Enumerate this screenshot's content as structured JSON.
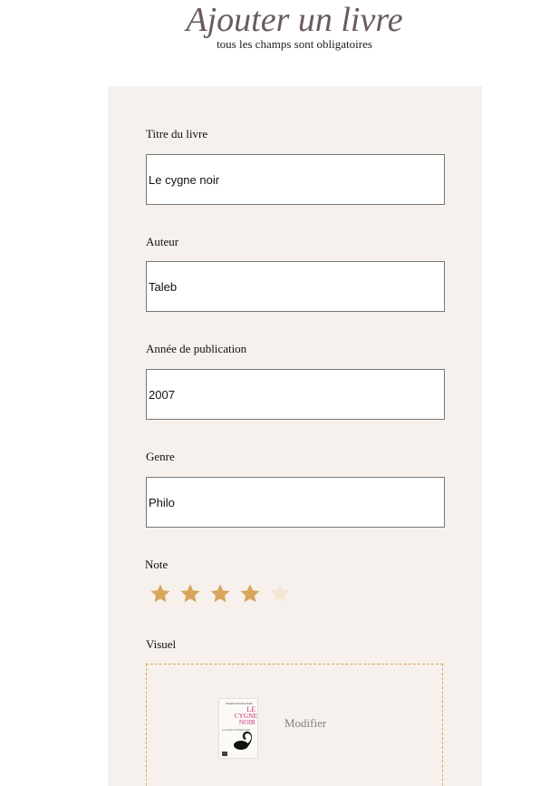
{
  "header": {
    "title": "Ajouter un livre",
    "subtitle": "tous les champs sont obligatoires"
  },
  "form": {
    "fields": [
      {
        "label": "Titre du livre",
        "value": "Le cygne noir"
      },
      {
        "label": "Auteur",
        "value": "Taleb"
      },
      {
        "label": "Année de publication",
        "value": "2007"
      },
      {
        "label": "Genre",
        "value": "Philo"
      }
    ],
    "rating": {
      "label": "Note",
      "value": 4,
      "max": 5
    },
    "visual": {
      "label": "Visuel",
      "cover_text": {
        "author": "Nassim Nicholas Taleb",
        "title_line1": "LE",
        "title_line2": "CYGNE",
        "title_line3": "NOIR",
        "subtitle": "La puissance de l'imprévisible"
      },
      "modify_label": "Modifier"
    }
  },
  "colors": {
    "card_background": "#f6f1ec",
    "star_filled": "#d8a55d",
    "star_empty": "#f3e6d3",
    "title": "#6b5b5b",
    "upload_border": "#d8a55d"
  }
}
